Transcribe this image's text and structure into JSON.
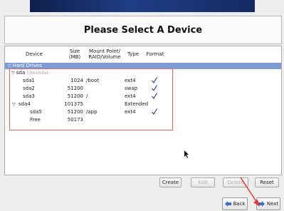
{
  "header": {
    "title": "Please Select A Device"
  },
  "table": {
    "columns": [
      "Device",
      "Size\n(MB)",
      "Mount Point/\nRAID/Volume",
      "Type",
      "Format"
    ],
    "group_label": "Hard Drives",
    "disk": {
      "name": "sda",
      "path": "(/dev/sda)"
    },
    "rows": [
      {
        "device": "sda1",
        "size": "1024",
        "mount": "/boot",
        "type": "ext4",
        "format": true
      },
      {
        "device": "sda2",
        "size": "51200",
        "mount": "",
        "type": "swap",
        "format": true
      },
      {
        "device": "sda3",
        "size": "51200",
        "mount": "/",
        "type": "ext4",
        "format": true
      },
      {
        "device": "sda4",
        "size": "101375",
        "mount": "",
        "type": "Extended",
        "format": false
      },
      {
        "device": "sda5",
        "size": "51200",
        "mount": "/app",
        "type": "ext4",
        "format": true
      },
      {
        "device": "Free",
        "size": "50173",
        "mount": "",
        "type": "",
        "format": false
      }
    ]
  },
  "actions": {
    "create": "Create",
    "edit": "Edit",
    "delete": "Delete",
    "reset": "Reset"
  },
  "nav": {
    "back": "Back",
    "next": "Next"
  },
  "colors": {
    "group_bg": "#7b9bd2",
    "highlight_box": "#e5636d",
    "annotation_arrow": "#e53935",
    "check": "#2a3e7a"
  }
}
